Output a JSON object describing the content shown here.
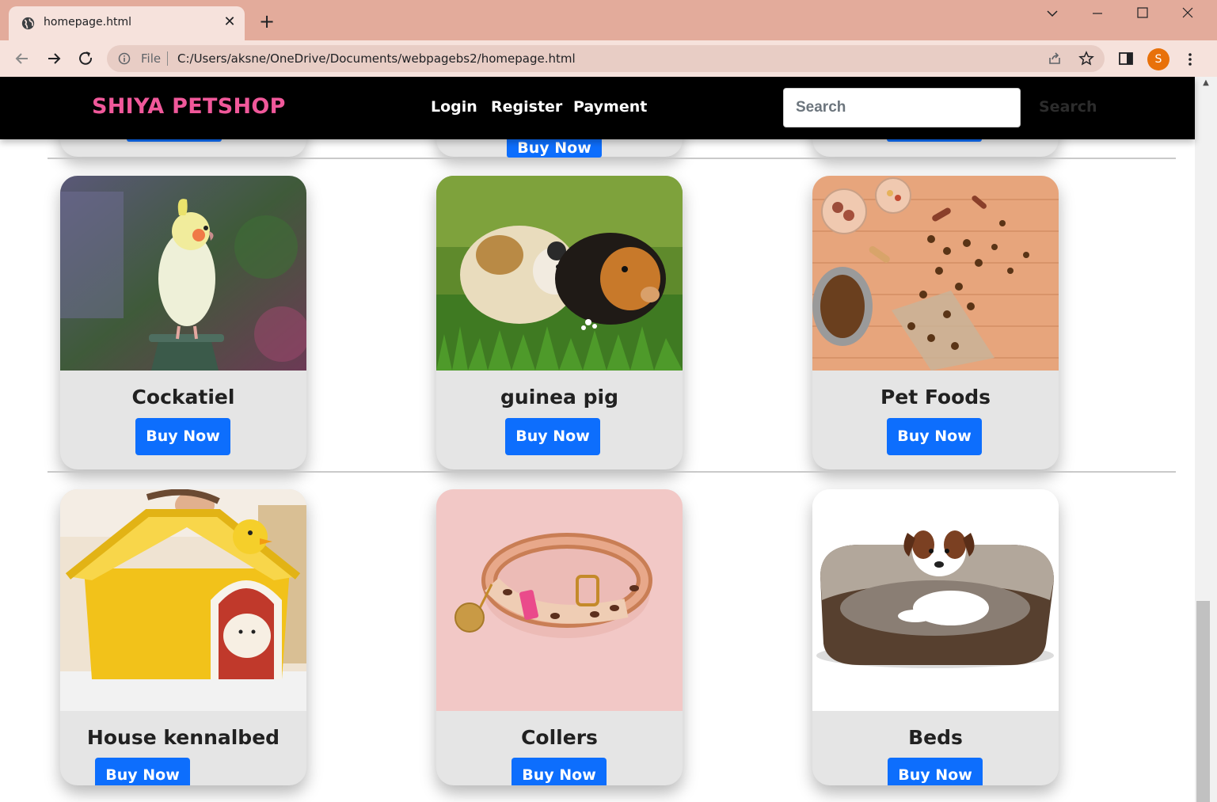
{
  "browser": {
    "tab_title": "homepage.html",
    "tab_close": "✕",
    "new_tab": "+",
    "file_label": "File",
    "url": "C:/Users/aksne/OneDrive/Documents/webpagebs2/homepage.html",
    "profile_initial": "S",
    "colors": {
      "frame": "#e3ab9b",
      "toolbar": "#f6e2dc",
      "avatar": "#e8710a"
    }
  },
  "navbar": {
    "brand": "SHIYA PETSHOP",
    "links": [
      "Login",
      "Register",
      "Payment"
    ],
    "search_placeholder": "Search",
    "search_button": "Search",
    "colors": {
      "background": "#000000",
      "brand": "#f0589a"
    }
  },
  "previous_row": {
    "button_label": "Buy Now"
  },
  "products": [
    {
      "title": "Cockatiel",
      "button": "Buy Now",
      "image": "cockatiel-photo"
    },
    {
      "title": "guinea pig",
      "button": "Buy Now",
      "image": "guinea-pigs-photo"
    },
    {
      "title": "Pet Foods",
      "button": "Buy Now",
      "image": "pet-food-photo"
    },
    {
      "title": "House kennalbed",
      "button": "Buy Now",
      "image": "kennel-bed-photo"
    },
    {
      "title": "Collers",
      "button": "Buy Now",
      "image": "collar-photo"
    },
    {
      "title": "Beds",
      "button": "Buy Now",
      "image": "dog-bed-photo"
    }
  ],
  "colors": {
    "button": "#0d6efd",
    "card": "#e5e5e5"
  }
}
